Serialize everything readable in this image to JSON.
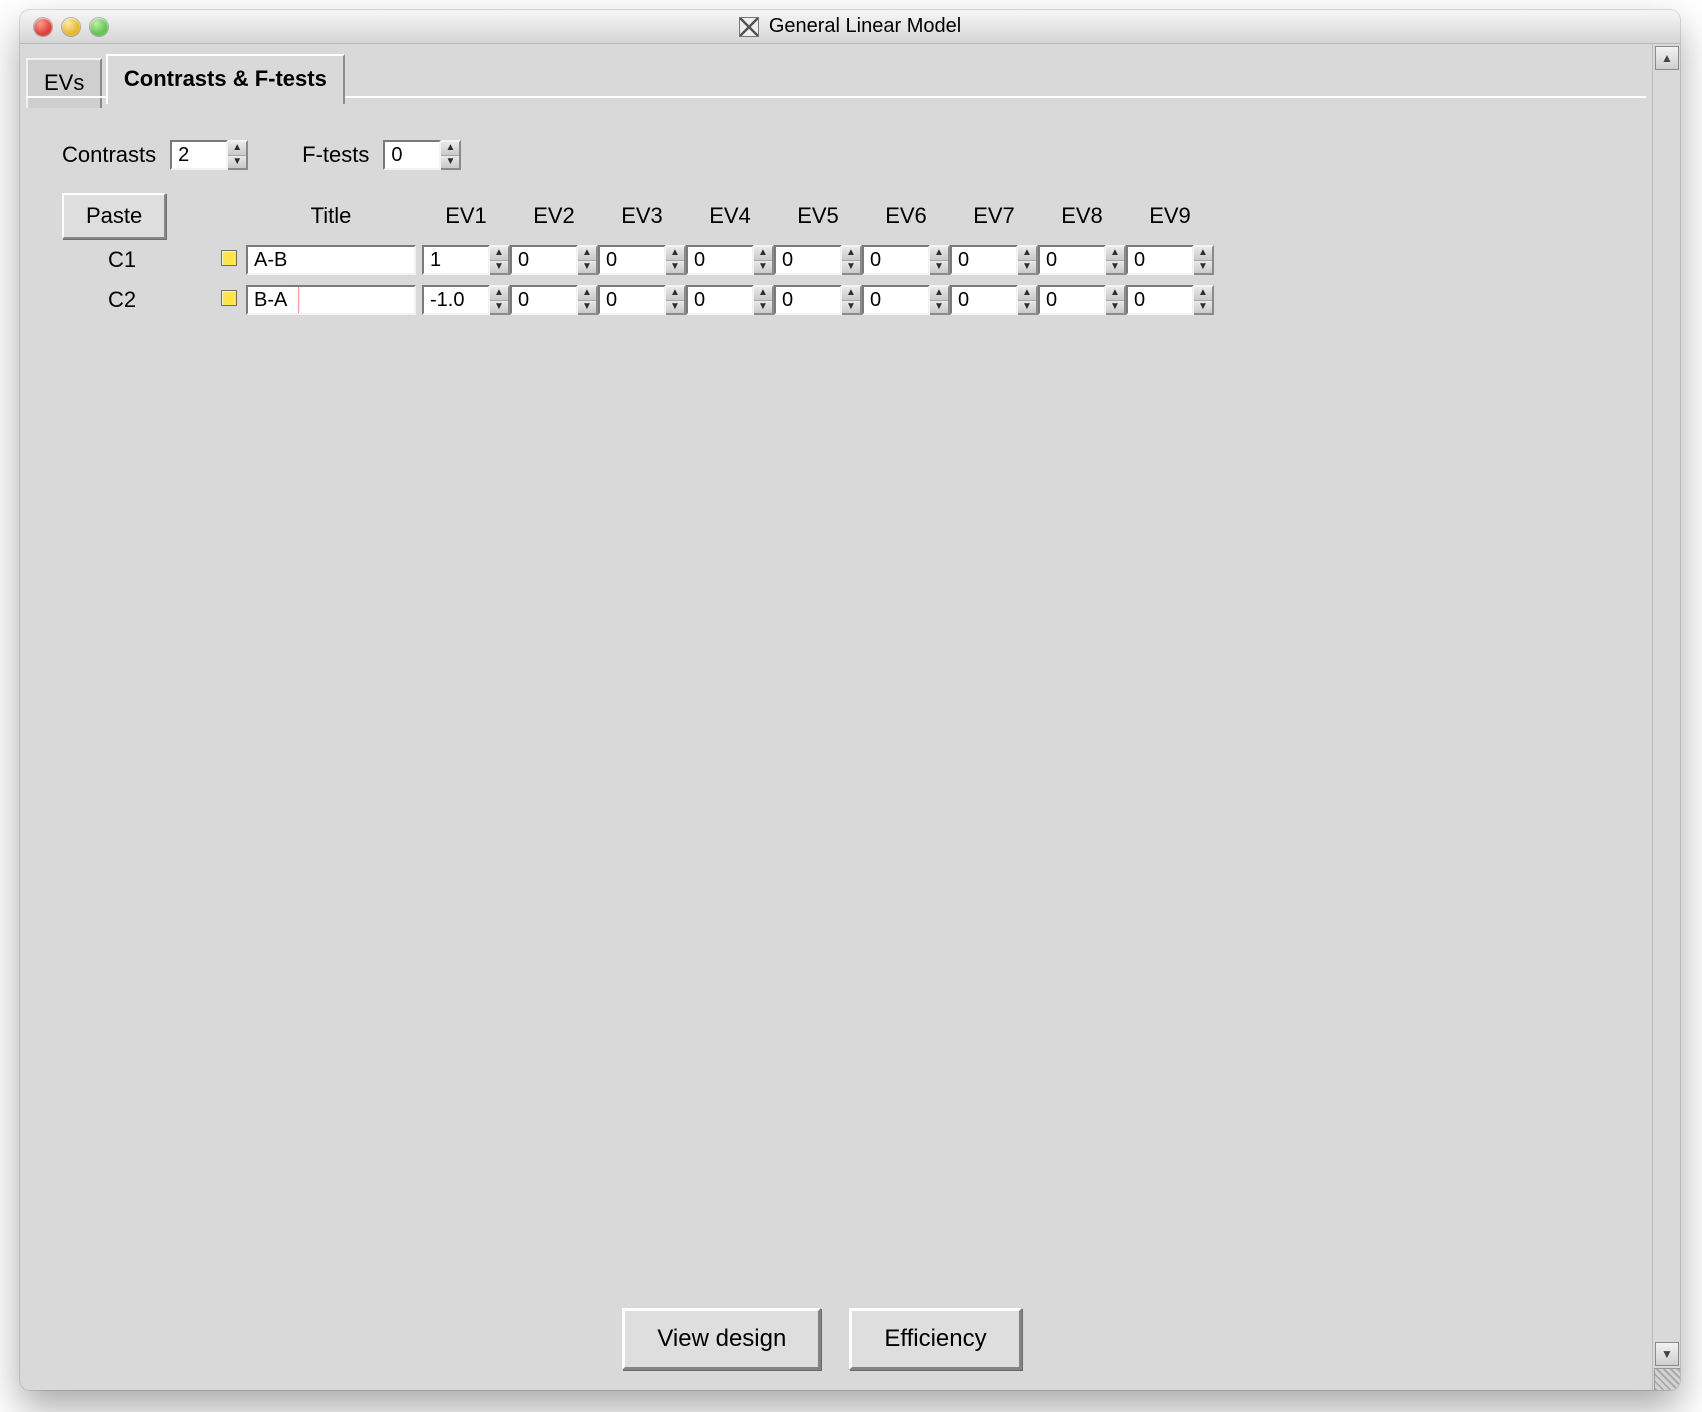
{
  "window": {
    "title": "General Linear Model"
  },
  "tabs": {
    "evs": "EVs",
    "contrasts": "Contrasts & F-tests"
  },
  "controls": {
    "contrasts_label": "Contrasts",
    "contrasts_value": "2",
    "ftests_label": "F-tests",
    "ftests_value": "0",
    "paste_label": "Paste",
    "title_header": "Title"
  },
  "ev_headers": [
    "EV1",
    "EV2",
    "EV3",
    "EV4",
    "EV5",
    "EV6",
    "EV7",
    "EV8",
    "EV9"
  ],
  "rows": [
    {
      "id": "C1",
      "title": "A-B",
      "values": [
        "1",
        "0",
        "0",
        "0",
        "0",
        "0",
        "0",
        "0",
        "0"
      ]
    },
    {
      "id": "C2",
      "title": "B-A",
      "values": [
        "-1.0",
        "0",
        "0",
        "0",
        "0",
        "0",
        "0",
        "0",
        "0"
      ]
    }
  ],
  "buttons": {
    "view_design": "View design",
    "efficiency": "Efficiency"
  }
}
